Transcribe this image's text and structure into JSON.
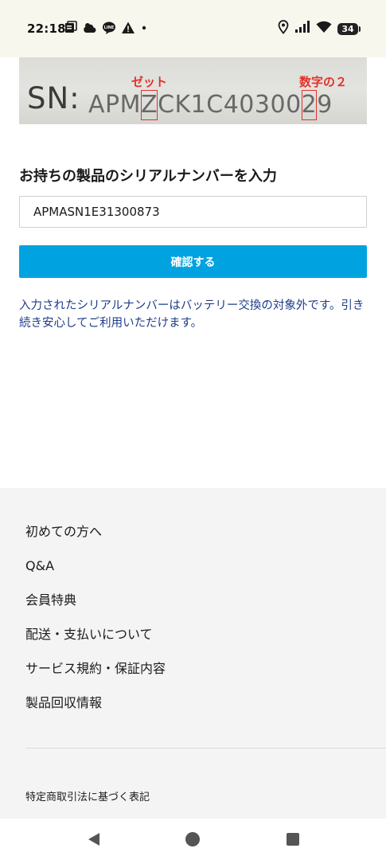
{
  "status_bar": {
    "time": "22:18",
    "battery_level": "34",
    "left_icons": [
      "notification-app-icon",
      "weather-icon",
      "line-app-icon",
      "warning-icon",
      "dot-icon"
    ],
    "right_icons": [
      "location-icon",
      "signal-icon",
      "wifi-icon",
      "battery-icon"
    ]
  },
  "sn_banner": {
    "label": "SN:",
    "serial_before": "APM",
    "serial_highlight_1": "Z",
    "serial_middle": "CK1C40300",
    "serial_highlight_2": "2",
    "serial_after": "9",
    "annotation_1": "ゼット",
    "annotation_2": "数字の２",
    "annotation_color": "#e0332a"
  },
  "form": {
    "heading": "お持ちの製品のシリアルナンバーを入力",
    "serial_value": "APMASN1E31300873",
    "confirm_label": "確認する",
    "result_message": "入力されたシリアルナンバーはバッテリー交換の対象外です。引き続き安心してご利用いただけます。"
  },
  "footer": {
    "links": [
      "初めての方へ",
      "Q&A",
      "会員特典",
      "配送・支払いについて",
      "サービス規約・保証内容",
      "製品回収情報"
    ],
    "legal": "特定商取引法に基づく表記"
  },
  "colors": {
    "accent": "#00a3df",
    "message": "#1d3c8a",
    "footer_bg": "#f4f4f4",
    "status_bg": "#f7f7ee"
  }
}
